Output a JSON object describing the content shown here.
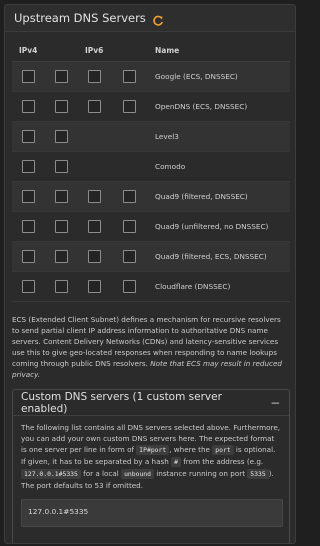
{
  "panel": {
    "title": "Upstream DNS Servers"
  },
  "table": {
    "headers": {
      "ipv4": "IPv4",
      "ipv6": "IPv6",
      "name": "Name"
    },
    "rows": [
      {
        "name": "Google (ECS, DNSSEC)",
        "ipv4": [
          false,
          false
        ],
        "ipv6": [
          false,
          false
        ]
      },
      {
        "name": "OpenDNS (ECS, DNSSEC)",
        "ipv4": [
          false,
          false
        ],
        "ipv6": [
          false,
          false
        ]
      },
      {
        "name": "Level3",
        "ipv4": [
          false,
          false
        ],
        "ipv6": []
      },
      {
        "name": "Comodo",
        "ipv4": [
          false,
          false
        ],
        "ipv6": []
      },
      {
        "name": "Quad9 (filtered, DNSSEC)",
        "ipv4": [
          false,
          false
        ],
        "ipv6": [
          false,
          false
        ]
      },
      {
        "name": "Quad9 (unfiltered, no DNSSEC)",
        "ipv4": [
          false,
          false
        ],
        "ipv6": [
          false,
          false
        ]
      },
      {
        "name": "Quad9 (filtered, ECS, DNSSEC)",
        "ipv4": [
          false,
          false
        ],
        "ipv6": [
          false,
          false
        ]
      },
      {
        "name": "Cloudflare (DNSSEC)",
        "ipv4": [
          false,
          false
        ],
        "ipv6": [
          false,
          false
        ]
      }
    ]
  },
  "description": {
    "text": "ECS (Extended Client Subnet) defines a mechanism for recursive resolvers to send partial client IP address information to authoritative DNS name servers. Content Delivery Networks (CDNs) and latency-sensitive services use this to give geo-located responses when responding to name lookups coming through public DNS resolvers.",
    "note": "Note that ECS may result in reduced privacy."
  },
  "custom": {
    "title": "Custom DNS servers (1 custom server enabled)",
    "collapse_label": "−",
    "help": {
      "p1": "The following list contains all DNS servers selected above. Furthermore, you can add your own custom DNS servers here. The expected format is one server per line in form of ",
      "code1": "IP#port",
      "p2": ", where the ",
      "code2": "port",
      "p3": " is optional. If given, it has to be separated by a hash ",
      "code3": "#",
      "p4": " from the address (e.g. ",
      "code4": "127.0.0.1#5335",
      "p5": " for a local ",
      "code5": "unbound",
      "p6": " instance running on port ",
      "code6": "5335",
      "p7": "). The port defaults to 53 if omitted."
    },
    "textarea_value": "127.0.0.1#5335"
  },
  "colors": {
    "accent": "#f0a030",
    "background": "#1f1f1f",
    "panel": "#2b2b2b"
  },
  "icons": {
    "refresh": "refresh-icon",
    "collapse": "minus-icon"
  }
}
